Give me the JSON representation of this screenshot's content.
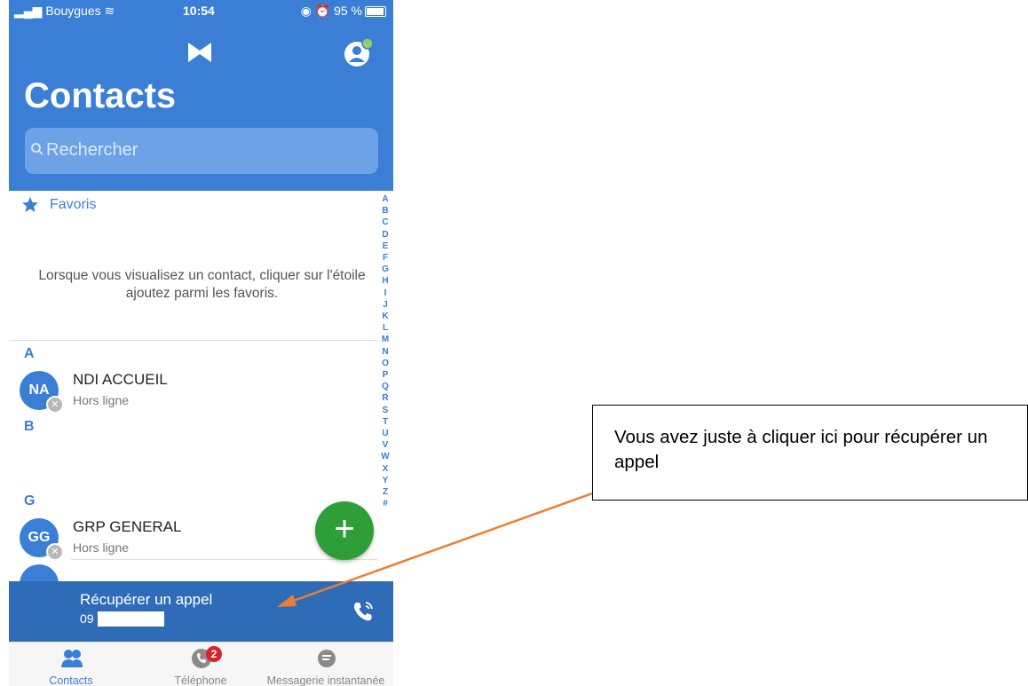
{
  "status_bar": {
    "carrier": "Bouygues",
    "time": "10:54",
    "battery": "95 %"
  },
  "header": {
    "title": "Contacts",
    "search_placeholder": "Rechercher"
  },
  "favorites": {
    "label": "Favoris",
    "empty_text": "Lorsque vous visualisez un contact, cliquer sur l'étoile ajoutez parmi les favoris."
  },
  "sections": [
    {
      "letter": "A"
    },
    {
      "letter": "B"
    },
    {
      "letter": "G"
    }
  ],
  "contacts": [
    {
      "initials": "NA",
      "name": "NDI ACCUEIL",
      "status": "Hors ligne"
    },
    {
      "initials": "GG",
      "name": "GRP GENERAL",
      "status": "Hors ligne"
    }
  ],
  "alphabet": [
    "A",
    "B",
    "C",
    "D",
    "E",
    "F",
    "G",
    "H",
    "I",
    "J",
    "K",
    "L",
    "M",
    "N",
    "O",
    "P",
    "Q",
    "R",
    "S",
    "T",
    "U",
    "V",
    "W",
    "X",
    "Y",
    "Z",
    "#"
  ],
  "fab_label": "+",
  "recover_call": {
    "label": "Récupérer un appel",
    "number": "09"
  },
  "tabs": [
    {
      "label": "Contacts",
      "icon": "contacts-icon",
      "active": true
    },
    {
      "label": "Téléphone",
      "icon": "phone-icon",
      "badge": "2"
    },
    {
      "label": "Messagerie instantanée",
      "icon": "chat-icon"
    }
  ],
  "annotation": {
    "text": "Vous avez juste à cliquer ici pour récupérer un appel"
  },
  "colors": {
    "primary": "#3a7fd5",
    "recover_bar": "#2f6cb8",
    "fab": "#2e9e38",
    "arrow": "#ed7d31",
    "badge": "#d9222a"
  }
}
